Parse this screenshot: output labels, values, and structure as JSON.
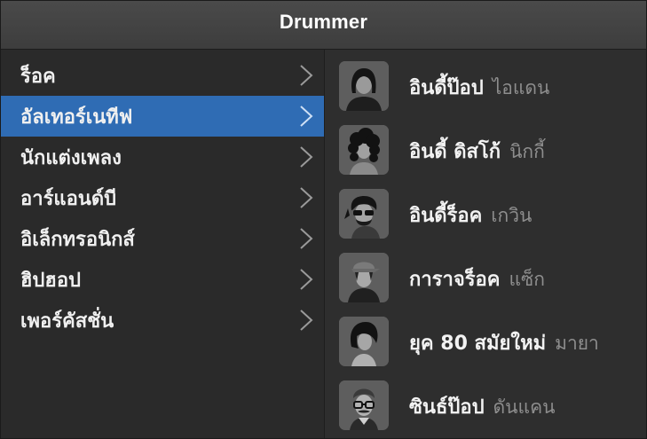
{
  "window": {
    "title": "Drummer"
  },
  "genres": [
    {
      "label": "ร็อค",
      "selected": false
    },
    {
      "label": "อัลเทอร์เนทีฟ",
      "selected": true
    },
    {
      "label": "นักแต่งเพลง",
      "selected": false
    },
    {
      "label": "อาร์แอนด์บี",
      "selected": false
    },
    {
      "label": "อิเล็กทรอนิกส์",
      "selected": false
    },
    {
      "label": "ฮิปฮอป",
      "selected": false
    },
    {
      "label": "เพอร์คัสชั่น",
      "selected": false
    }
  ],
  "drummers": [
    {
      "style": "อินดี้ป๊อป",
      "name": "ไอแดน",
      "avatar_icon": "drummer-avatar-long-hair"
    },
    {
      "style": "อินดี้ ดิสโก้",
      "name": "นิกกี้",
      "avatar_icon": "drummer-avatar-curly-hair"
    },
    {
      "style": "อินดี้ร็อค",
      "name": "เกวิน",
      "avatar_icon": "drummer-avatar-sunglasses-beard"
    },
    {
      "style": "การาจร็อค",
      "name": "แซ็ก",
      "avatar_icon": "drummer-avatar-cap"
    },
    {
      "style": "ยุค 80 สมัยใหม่",
      "name": "มายา",
      "avatar_icon": "drummer-avatar-bob-hair"
    },
    {
      "style": "ซินธ์ป๊อป",
      "name": "ดันแคน",
      "avatar_icon": "drummer-avatar-glasses-mustache"
    }
  ],
  "colors": {
    "selection": "#2f6cb4",
    "list_background": "#2a2a2a",
    "secondary_text": "#8e8e8e"
  }
}
